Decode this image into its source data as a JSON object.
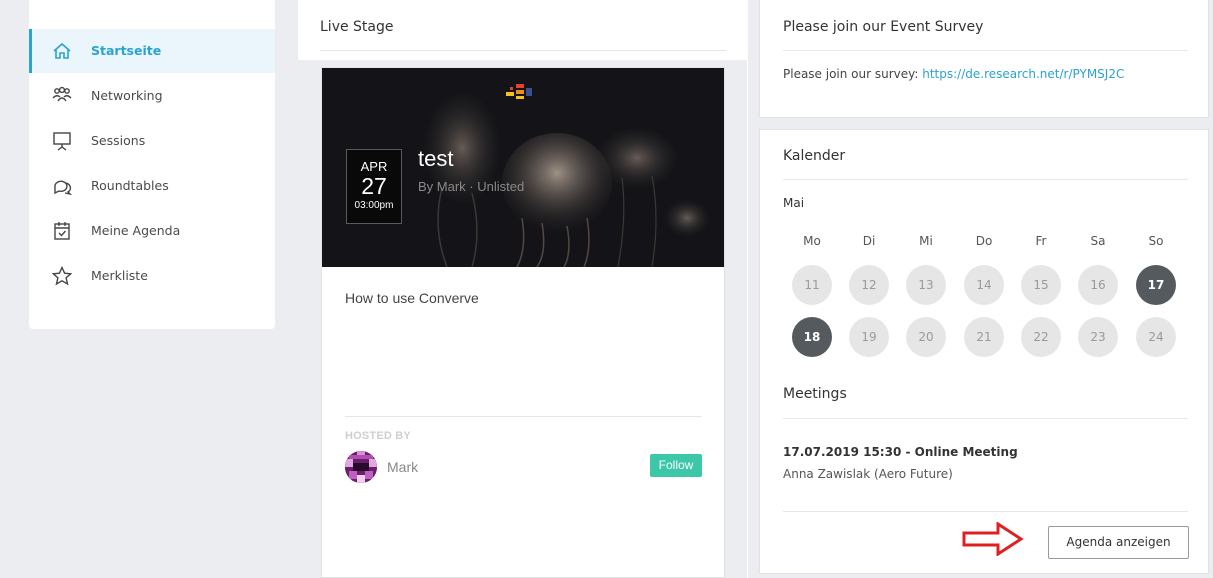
{
  "sidebar": {
    "items": [
      {
        "label": "Startseite",
        "icon": "home-icon",
        "active": true
      },
      {
        "label": "Networking",
        "icon": "people-icon"
      },
      {
        "label": "Sessions",
        "icon": "presentation-icon"
      },
      {
        "label": "Roundtables",
        "icon": "chat-bubbles-icon"
      },
      {
        "label": "Meine Agenda",
        "icon": "calendar-check-icon"
      },
      {
        "label": "Merkliste",
        "icon": "star-icon"
      }
    ]
  },
  "stage": {
    "title": "Live Stage",
    "session": {
      "month": "APR",
      "day": "27",
      "time": "03:00pm",
      "title": "test",
      "subtitle": "By Mark · Unlisted",
      "description": "How to use Converve",
      "hosted_by_label": "HOSTED BY",
      "host_name": "Mark",
      "follow_label": "Follow"
    }
  },
  "survey": {
    "title": "Please join our Event Survey",
    "text": "Please join our survey: ",
    "link": "https://de.research.net/r/PYMSJ2C"
  },
  "calendar": {
    "title": "Kalender",
    "month": "Mai",
    "weekdays": [
      "Mo",
      "Di",
      "Mi",
      "Do",
      "Fr",
      "Sa",
      "So"
    ],
    "weeks": [
      [
        "11",
        "12",
        "13",
        "14",
        "15",
        "16",
        "17"
      ],
      [
        "18",
        "19",
        "20",
        "21",
        "22",
        "23",
        "24"
      ]
    ],
    "highlighted_days": [
      "17",
      "18"
    ]
  },
  "meetings": {
    "title": "Meetings",
    "items": [
      {
        "title": "17.07.2019 15:30 - Online Meeting",
        "subtitle": "Anna Zawislak (Aero Future)"
      }
    ],
    "button_label": "Agenda anzeigen"
  },
  "colors": {
    "accent": "#2aa3cf",
    "follow": "#3cc8a8",
    "highlight_day": "#555a5f",
    "annotation_arrow": "#e02020"
  }
}
